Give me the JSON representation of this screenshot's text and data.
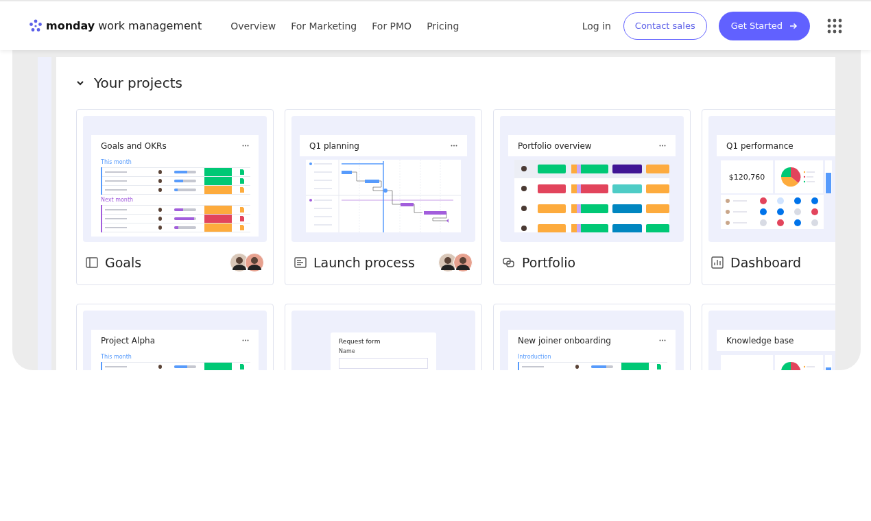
{
  "header": {
    "logo": {
      "brand": "monday",
      "product": "work management"
    },
    "nav": [
      {
        "label": "Overview"
      },
      {
        "label": "For Marketing"
      },
      {
        "label": "For PMO"
      },
      {
        "label": "Pricing"
      }
    ],
    "login": "Log in",
    "contact": "Contact sales",
    "cta": "Get Started"
  },
  "section": {
    "title": "Your projects",
    "expanded": true
  },
  "projects": [
    {
      "name": "Goals",
      "members": [
        {
          "kind": "avatar"
        },
        {
          "kind": "avatar"
        }
      ],
      "preview": {
        "kind": "table",
        "title": "Goals and OKRs",
        "groups": [
          {
            "label": "This month",
            "color": "#579bfc",
            "rows": [
              {
                "level": 0.6,
                "color": "#00c875"
              },
              {
                "level": 0.4,
                "color": "#00c875"
              },
              {
                "level": 0.15,
                "color": "#fdab3d"
              }
            ]
          },
          {
            "label": "Next month",
            "color": "#a25ddc",
            "rows": [
              {
                "level": 0.4,
                "color": "#fdab3d"
              },
              {
                "level": 0.9,
                "color": "#e2445c"
              },
              {
                "level": 0.2,
                "color": "#fdab3d"
              }
            ]
          }
        ]
      }
    },
    {
      "name": "Launch process",
      "members": [
        {
          "kind": "avatar"
        },
        {
          "kind": "avatar"
        }
      ],
      "preview": {
        "kind": "gantt",
        "title": "Q1 planning"
      }
    },
    {
      "name": "Portfolio",
      "preview": {
        "kind": "portfolio",
        "title": "Portfolio overview"
      }
    },
    {
      "name": "Dashboard",
      "preview": {
        "kind": "dashboard",
        "title": "Q1 performance",
        "value": "$120,760"
      }
    },
    {
      "preview": {
        "kind": "table",
        "title": "Project Alpha",
        "groups": [
          {
            "label": "This month",
            "color": "#579bfc",
            "rows": [
              {
                "level": 0.6,
                "color": "#00c875"
              }
            ]
          }
        ]
      }
    },
    {
      "preview": {
        "kind": "form",
        "title": "Request form",
        "field": "Name"
      }
    },
    {
      "preview": {
        "kind": "table",
        "title": "New joiner onboarding",
        "groups": [
          {
            "label": "Introduction",
            "color": "#579bfc",
            "rows": [
              {
                "level": 0.7,
                "color": "#00c875"
              }
            ]
          }
        ]
      }
    },
    {
      "preview": {
        "kind": "dashboard",
        "title": "Knowledge base"
      }
    }
  ]
}
